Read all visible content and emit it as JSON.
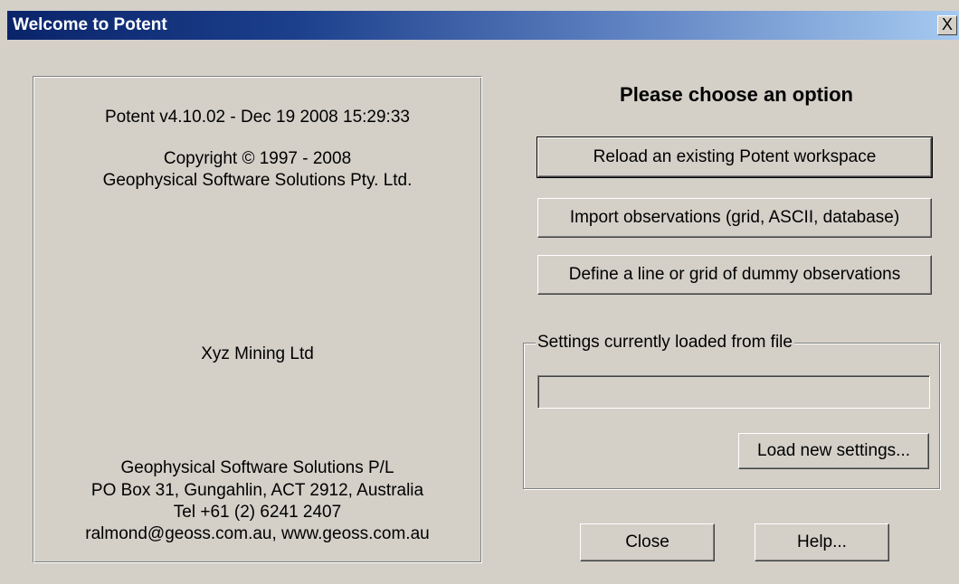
{
  "window": {
    "title": "Welcome to Potent",
    "close_glyph": "X"
  },
  "info": {
    "version": "Potent v4.10.02 - Dec 19 2008 15:29:33",
    "copyright": "Copyright © 1997 - 2008",
    "company": "Geophysical Software Solutions Pty. Ltd.",
    "licensee": "Xyz Mining Ltd",
    "address_name": "Geophysical Software Solutions P/L",
    "address_po": "PO Box 31,  Gungahlin,  ACT 2912,  Australia",
    "phone": "Tel +61 (2) 6241 2407",
    "web": "ralmond@geoss.com.au,   www.geoss.com.au"
  },
  "options": {
    "prompt": "Please choose an option",
    "reload_label": "Reload an existing Potent workspace",
    "import_label": "Import observations (grid, ASCII, database)",
    "define_label": "Define a line or grid of dummy observations"
  },
  "settings": {
    "group_label": "Settings currently loaded from file",
    "file_value": "",
    "load_label": "Load new settings..."
  },
  "footer": {
    "close_label": "Close",
    "help_label": "Help..."
  }
}
